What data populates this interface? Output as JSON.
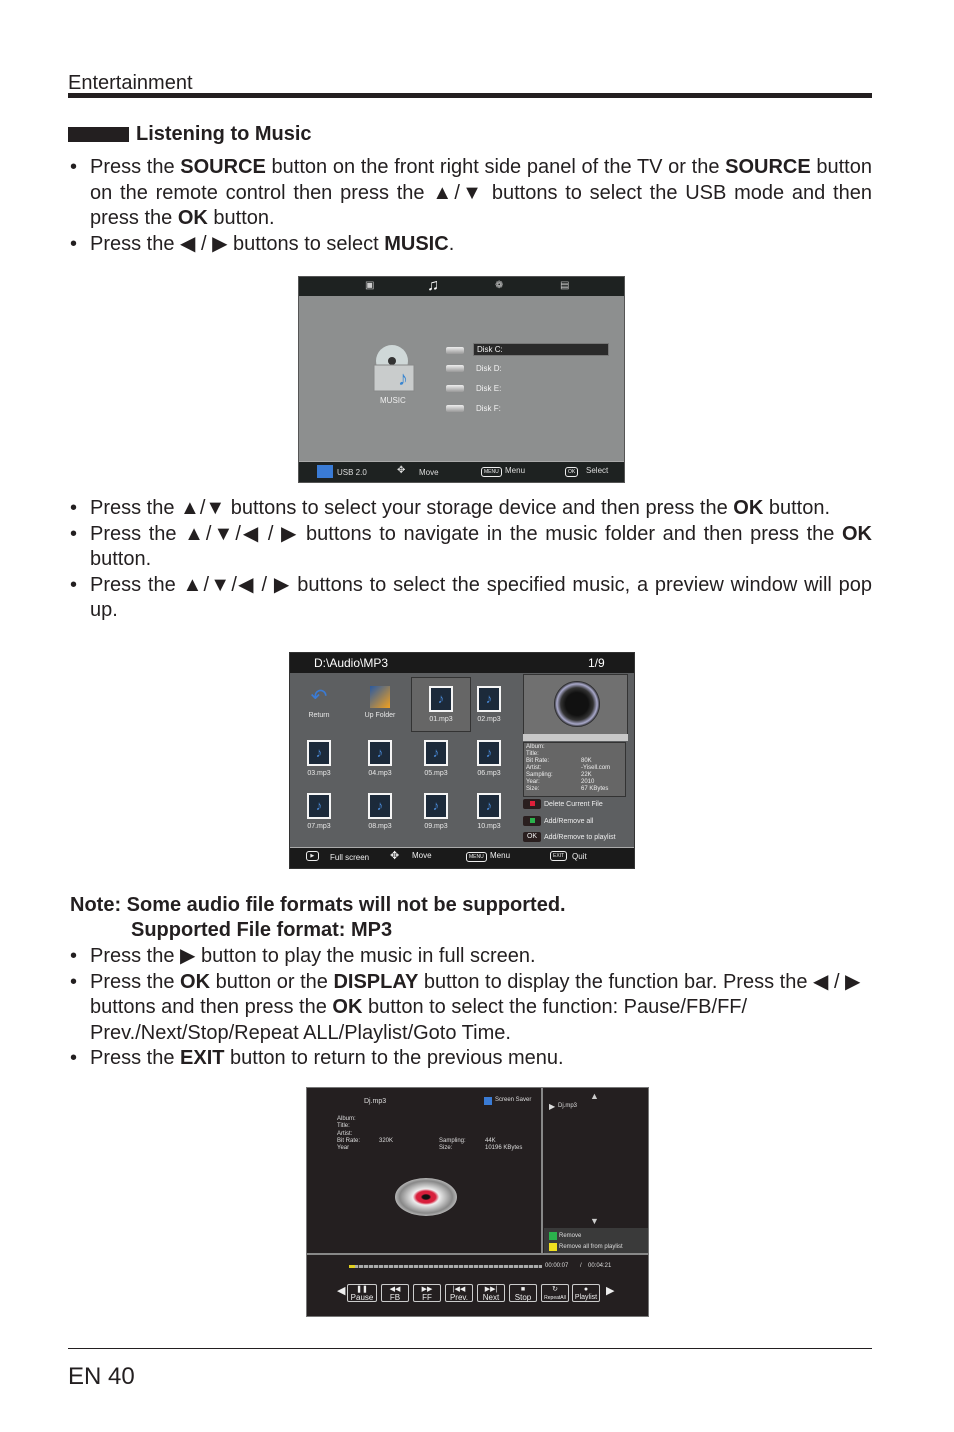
{
  "header": {
    "section": "Entertainment"
  },
  "heading": "Listening to Music",
  "bullets_a": [
    {
      "p1": "Press the ",
      "b1": "SOURCE",
      "p2": " button on the front right side panel of the TV or the ",
      "b2": "SOURCE",
      "p3": " button on the remote control then press the ▲/▼ buttons to select the USB mode and then press the ",
      "b3": "OK",
      "p4": " button."
    },
    {
      "p1": "Press the ◀ / ▶ buttons to select ",
      "b1": "MUSIC",
      "p2": "."
    }
  ],
  "bullets_b": [
    {
      "p1": "Press the ▲/▼ buttons to select your storage device and then press the ",
      "b1": "OK",
      "p2": " button."
    },
    {
      "p1": "Press the ▲/▼/◀ / ▶ buttons to navigate in the music folder and then press the ",
      "b1": "OK",
      "p2": " button."
    },
    {
      "p1": "Press the ▲/▼/◀ / ▶ buttons to select the specified music, a preview window will pop up."
    }
  ],
  "note": {
    "line1": "Note: Some audio file formats will not be supported.",
    "line2": "Supported File format: MP3"
  },
  "bullets_c": [
    {
      "p1": "Press the ▶ button to play the music in full screen."
    },
    {
      "p1": "Press the ",
      "b1": "OK",
      "p2": " button or the ",
      "b2": "DISPLAY",
      "p3": " button to display the function bar. Press the ◀ / ▶ buttons and then press the ",
      "b3": "OK",
      "p4": " button to select the function: Pause/FB/FF/ Prev./Next/Stop/Repeat ALL/Playlist/Goto Time."
    },
    {
      "p1": "Press the ",
      "b1": "EXIT",
      "p2": " button to return to the previous menu."
    }
  ],
  "screen1": {
    "tabs": [
      "photo-icon",
      "music-icon",
      "movie-icon",
      "text-icon"
    ],
    "category_label": "MUSIC",
    "disks": [
      "Disk C:",
      "Disk D:",
      "Disk E:",
      "Disk F:"
    ],
    "selected_disk": "Disk C:",
    "footer": {
      "usb": "USB 2.0",
      "move": "Move",
      "menu_key": "MENU",
      "menu": "Menu",
      "ok_key": "OK",
      "select": "Select"
    }
  },
  "screen2": {
    "path": "D:\\Audio\\MP3",
    "page": "1/9",
    "tiles": [
      "Return",
      "Up Folder",
      "01.mp3",
      "02.mp3",
      "03.mp3",
      "04.mp3",
      "05.mp3",
      "06.mp3",
      "07.mp3",
      "08.mp3",
      "09.mp3",
      "10.mp3"
    ],
    "selected_tile": "01.mp3",
    "info": [
      {
        "k": "Album:",
        "v": ""
      },
      {
        "k": "Title:",
        "v": ""
      },
      {
        "k": "Bit Rate:",
        "v": "80K"
      },
      {
        "k": "Artist:",
        "v": "-Yisell.com"
      },
      {
        "k": "Sampling:",
        "v": "22K"
      },
      {
        "k": "Year:",
        "v": "2010"
      },
      {
        "k": "Size:",
        "v": "67 KBytes"
      }
    ],
    "actions": [
      {
        "key": "red",
        "label": "Delete Current File",
        "color": "#e0203a"
      },
      {
        "key": "green",
        "label": "Add/Remove all",
        "color": "#2bb24c"
      },
      {
        "key": "OK",
        "label": "Add/Remove to playlist"
      }
    ],
    "footer": {
      "full": "Full screen",
      "move": "Move",
      "menu_key": "MENU",
      "menu": "Menu",
      "exit_key": "EXIT",
      "quit": "Quit"
    }
  },
  "screen3": {
    "file": "Dj.mp3",
    "screen_saver": "Screen Saver",
    "info_left": [
      {
        "k": "Album:",
        "v": ""
      },
      {
        "k": "Title:",
        "v": ""
      },
      {
        "k": "Artist:",
        "v": ""
      },
      {
        "k": "Bit Rate:",
        "v": "320K"
      },
      {
        "k": "Year",
        "v": ""
      }
    ],
    "info_right": [
      {
        "k": "Sampling:",
        "v": "44K"
      },
      {
        "k": "Size:",
        "v": "10196 KBytes"
      }
    ],
    "playlist": [
      "Dj.mp3"
    ],
    "playlist_actions": [
      {
        "label": "Remove",
        "color": "#2bb24c"
      },
      {
        "label": "Remove all from playlist",
        "color": "#f0e020"
      }
    ],
    "elapsed": "00:00:07",
    "separator": "/",
    "total": "00:04:21",
    "progress": 0.03,
    "controls": [
      {
        "glyph": "❚❚",
        "label": "Pause"
      },
      {
        "glyph": "◀◀",
        "label": "FB"
      },
      {
        "glyph": "▶▶",
        "label": "FF"
      },
      {
        "glyph": "|◀◀",
        "label": "Prev."
      },
      {
        "glyph": "▶▶|",
        "label": "Next"
      },
      {
        "glyph": "■",
        "label": "Stop"
      },
      {
        "glyph": "↻",
        "label": "RepeatAll"
      },
      {
        "glyph": "●",
        "label": "Playlist"
      }
    ]
  },
  "footer": {
    "page": "EN 40"
  }
}
